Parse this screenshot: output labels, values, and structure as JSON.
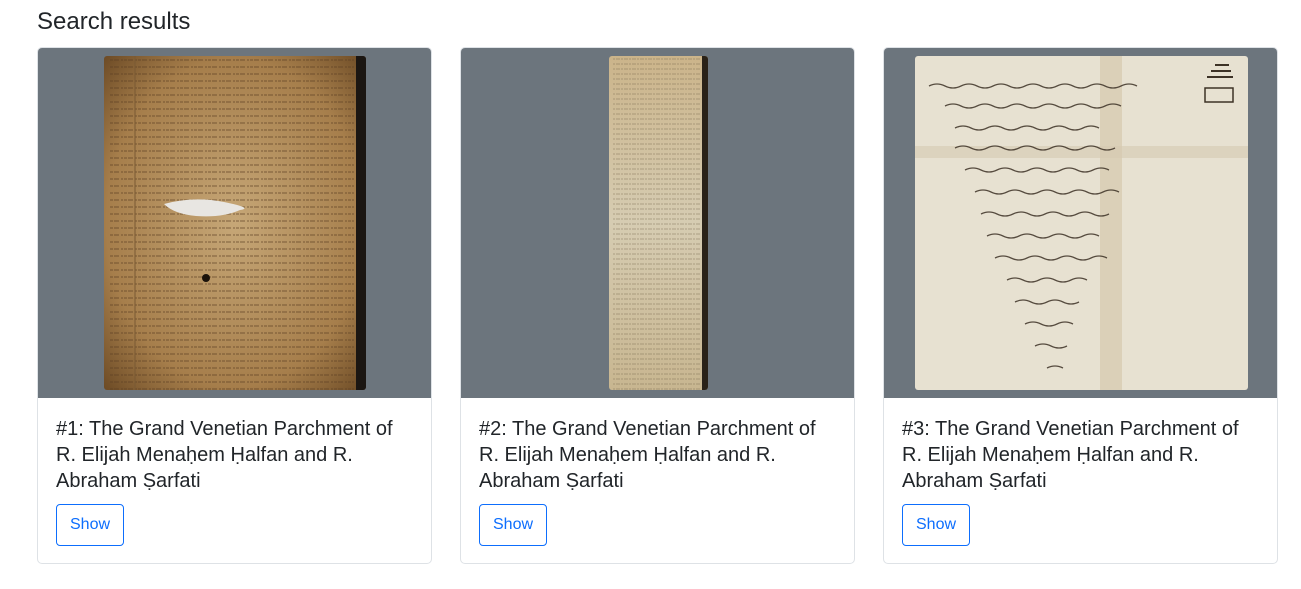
{
  "page": {
    "title": "Search results"
  },
  "results": [
    {
      "title": "#1: The Grand Venetian Parchment of R. Elijah Menaḥem Ḥalfan and R. Abraham Ṣarfati",
      "button_label": "Show",
      "image_alt": "Aged parchment manuscript with dense Hebrew text"
    },
    {
      "title": "#2: The Grand Venetian Parchment of R. Elijah Menaḥem Ḥalfan and R. Abraham Ṣarfati",
      "button_label": "Show",
      "image_alt": "Narrow parchment scroll strip with faded Hebrew text"
    },
    {
      "title": "#3: The Grand Venetian Parchment of R. Elijah Menaḥem Ḥalfan and R. Abraham Ṣarfati",
      "button_label": "Show",
      "image_alt": "Light parchment with handwritten Hebrew text in an inverted triangle"
    }
  ],
  "colors": {
    "image_backdrop": "#6c757d",
    "button_accent": "#0d6efd",
    "card_border": "#dee2e6"
  }
}
